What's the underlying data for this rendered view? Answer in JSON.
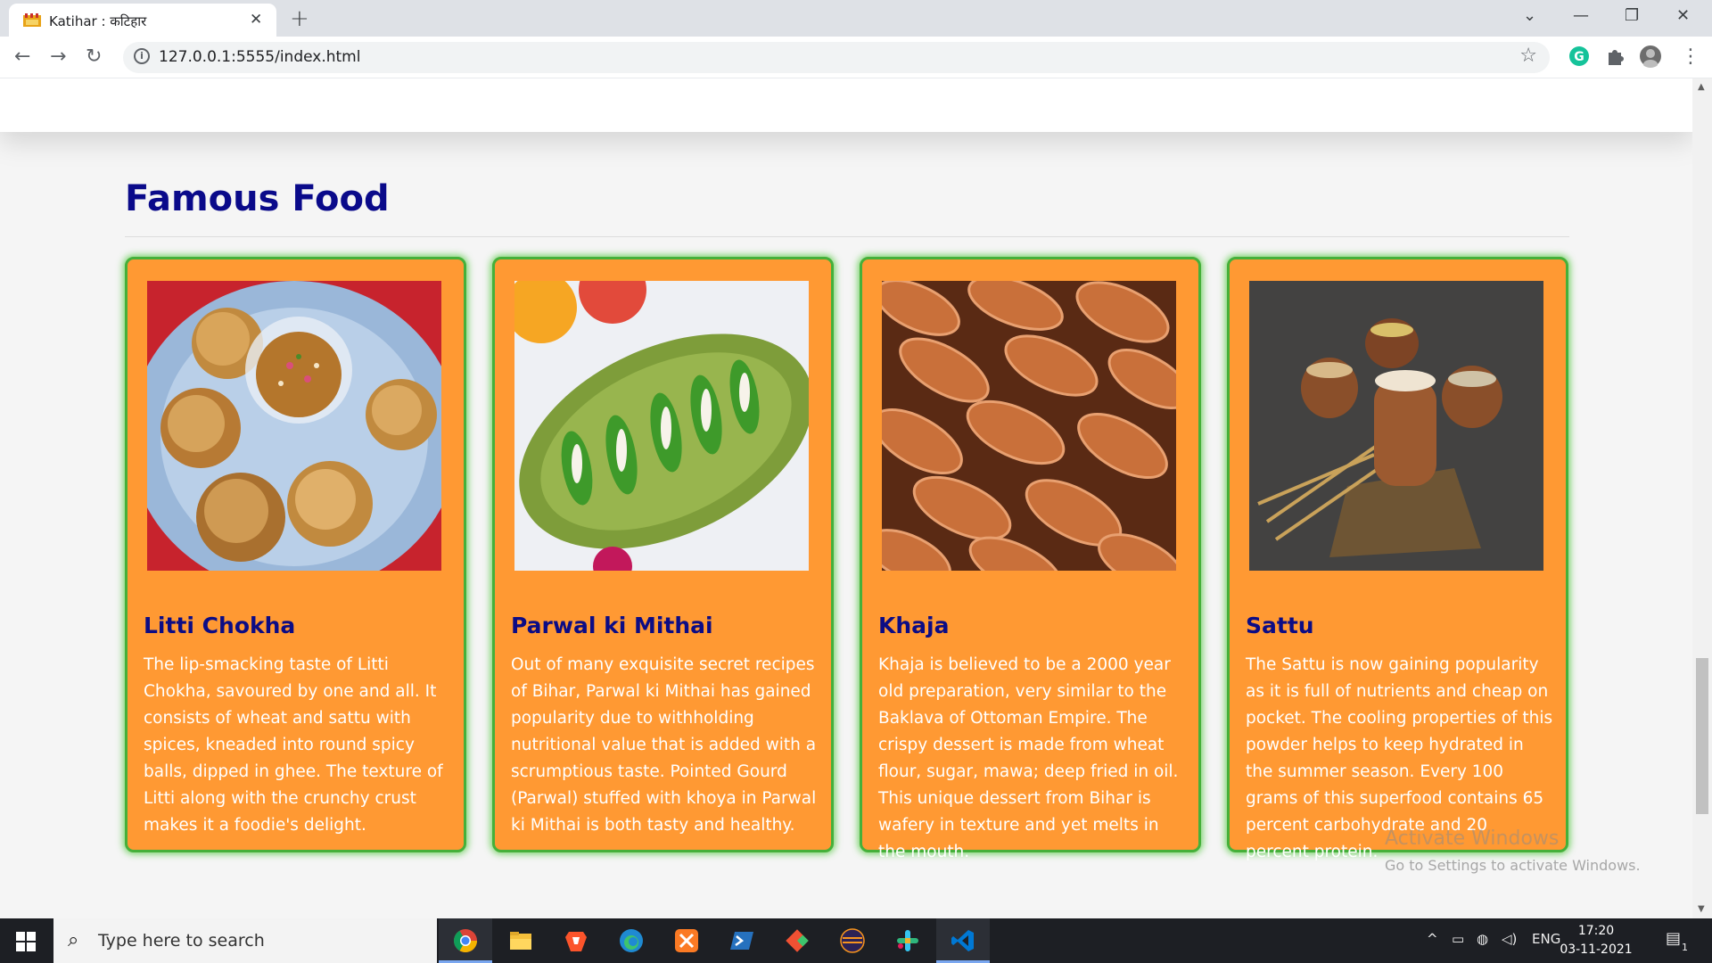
{
  "browser": {
    "tab_title": "Katihar : कटिहार",
    "tab_close": "✕",
    "new_tab": "+",
    "url": "127.0.0.1:5555/index.html",
    "win_controls": [
      "⌄",
      "—",
      "❐",
      "✕"
    ]
  },
  "page": {
    "section_title": "Famous Food",
    "foods": [
      {
        "name": "Litti Chokha",
        "description": "The lip-smacking taste of Litti Chokha, savoured by one and all. It consists of wheat and sattu with spices, kneaded into round spicy balls, dipped in ghee. The texture of Litti along with the crunchy crust makes it a foodie's delight."
      },
      {
        "name": "Parwal ki Mithai",
        "description": "Out of many exquisite secret recipes of Bihar, Parwal ki Mithai has gained popularity due to withholding nutritional value that is added with a scrumptious taste. Pointed Gourd (Parwal) stuffed with khoya in Parwal ki Mithai is both tasty and healthy."
      },
      {
        "name": "Khaja",
        "description": "Khaja is believed to be a 2000 year old preparation, very similar to the Baklava of Ottoman Empire. The crispy dessert is made from wheat flour, sugar, mawa; deep fried in oil. This unique dessert from Bihar is wafery in texture and yet melts in the mouth."
      },
      {
        "name": "Sattu",
        "description": "The Sattu is now gaining popularity as it is full of nutrients and cheap on pocket. The cooling properties of this powder helps to keep hydrated in the summer season. Every 100 grams of this superfood contains 65 percent carbohydrate and 20 percent protein."
      }
    ],
    "watermark_title": "Activate Windows",
    "watermark_sub": "Go to Settings to activate Windows."
  },
  "taskbar": {
    "search_placeholder": "Type here to search",
    "language": "ENG",
    "time": "17:20",
    "date": "03-11-2021",
    "notification_count": "1"
  },
  "colors": {
    "title_blue": "#0a0a8a",
    "card_orange": "#ff9933",
    "card_border_green": "#45b03a"
  }
}
